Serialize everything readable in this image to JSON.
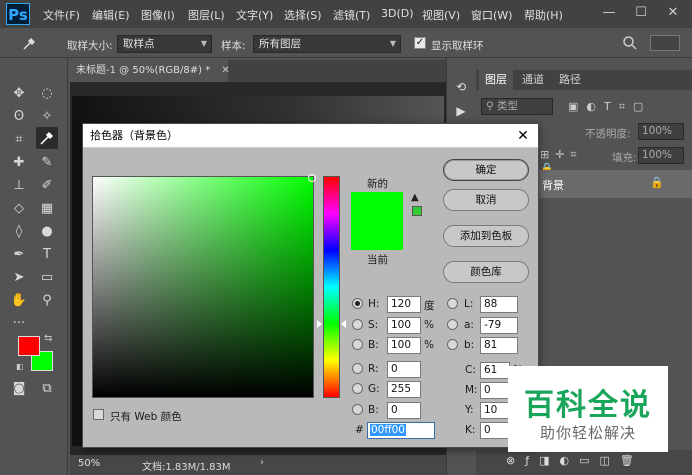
{
  "app": {
    "logo": "Ps"
  },
  "menu": [
    "文件(F)",
    "编辑(E)",
    "图像(I)",
    "图层(L)",
    "文字(Y)",
    "选择(S)",
    "滤镜(T)",
    "3D(D)",
    "视图(V)",
    "窗口(W)",
    "帮助(H)"
  ],
  "window_controls": {
    "minimize": "—",
    "maximize": "☐",
    "close": "✕"
  },
  "options_bar": {
    "sample_size_label": "取样大小:",
    "sample_size_value": "取样点",
    "sample_label": "样本:",
    "sample_value": "所有图层",
    "show_ring_label": "显示取样环",
    "show_ring_checked": true
  },
  "document": {
    "tab_title": "未标题-1 @ 50%(RGB/8#) *",
    "zoom": "50%",
    "doc_info": "文档:1.83M/1.83M"
  },
  "layers_panel": {
    "tabs": [
      "图层",
      "通道",
      "路径"
    ],
    "active_tab": "图层",
    "filter_label": "类型",
    "opacity_label": "不透明度:",
    "opacity_value": "100%",
    "fill_label": "填充:",
    "fill_value": "100%",
    "layer_name": "背景"
  },
  "color_picker": {
    "title": "拾色器（背景色）",
    "new_label": "新的",
    "current_label": "当前",
    "buttons": {
      "ok": "确定",
      "cancel": "取消",
      "add_swatch": "添加到色板",
      "color_libraries": "颜色库"
    },
    "hsb": {
      "h_label": "H:",
      "h": "120",
      "h_unit": "度",
      "s_label": "S:",
      "s": "100",
      "s_unit": "%",
      "b_label": "B:",
      "b": "100",
      "b_unit": "%"
    },
    "lab": {
      "l_label": "L:",
      "l": "88",
      "a_label": "a:",
      "a": "-79",
      "b_label": "b:",
      "b": "81"
    },
    "rgb": {
      "r_label": "R:",
      "r": "0",
      "g_label": "G:",
      "g": "255",
      "b_label": "B:",
      "b": "0"
    },
    "cmyk": {
      "c_label": "C:",
      "c": "61",
      "c_unit": "%",
      "m_label": "M:",
      "m": "0",
      "y_label": "Y:",
      "y": "10",
      "k_label": "K:",
      "k": "0"
    },
    "hex_label": "#",
    "hex": "00ff00",
    "web_only_label": "只有 Web 颜色",
    "selected_color": "#00ff00"
  },
  "tool_colors": {
    "foreground": "#ff0000",
    "background": "#00ff00"
  },
  "watermark": {
    "title": "百科全说",
    "subtitle": "助你轻松解决"
  }
}
